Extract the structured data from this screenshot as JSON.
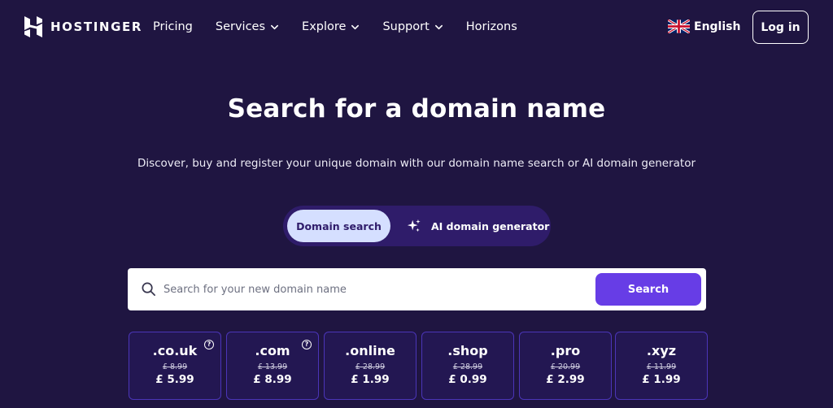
{
  "brand": {
    "name": "HOSTINGER"
  },
  "nav": {
    "items": [
      {
        "label": "Pricing",
        "dropdown": false
      },
      {
        "label": "Services",
        "dropdown": true
      },
      {
        "label": "Explore",
        "dropdown": true
      },
      {
        "label": "Support",
        "dropdown": true
      },
      {
        "label": "Horizons",
        "dropdown": false
      }
    ],
    "language": "English",
    "login_label": "Log in"
  },
  "hero": {
    "title": "Search for a domain name",
    "subtitle": "Discover, buy and register your unique domain with our domain name search or AI domain generator"
  },
  "mode_toggle": {
    "active_label": "Domain search",
    "ai_label": "AI domain generator"
  },
  "search": {
    "placeholder": "Search for your new domain name",
    "value": "",
    "button_label": "Search"
  },
  "tlds": [
    {
      "name": ".co.uk",
      "old_price": "£ 8.99",
      "new_price": "£ 5.99",
      "help": true
    },
    {
      "name": ".com",
      "old_price": "£ 13.99",
      "new_price": "£ 8.99",
      "help": true
    },
    {
      "name": ".online",
      "old_price": "£ 28.99",
      "new_price": "£ 1.99",
      "help": false
    },
    {
      "name": ".shop",
      "old_price": "£ 28.99",
      "new_price": "£ 0.99",
      "help": false
    },
    {
      "name": ".pro",
      "old_price": "£ 20.99",
      "new_price": "£ 2.99",
      "help": false
    },
    {
      "name": ".xyz",
      "old_price": "£ 11.99",
      "new_price": "£ 1.99",
      "help": false
    }
  ],
  "colors": {
    "background": "#1f1541",
    "accent": "#673de6",
    "toggle_active": "#d5dfff",
    "card_border": "#4b35b8"
  },
  "icons": {
    "logo": "hostinger-logo-icon",
    "chevron": "chevron-down-icon",
    "flag": "uk-flag-icon",
    "sparkle": "sparkle-icon",
    "search": "search-icon",
    "help": "question-circle-icon"
  }
}
